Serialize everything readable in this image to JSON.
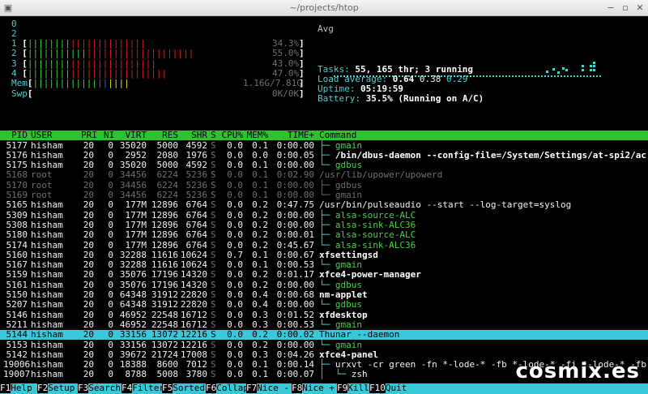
{
  "window": {
    "title": "~/projects/htop"
  },
  "cpus": [
    {
      "label": "1",
      "value": "34.3%",
      "green": 8,
      "red": 14
    },
    {
      "label": "2",
      "value": "55.0%",
      "green": 11,
      "red": 20
    },
    {
      "label": "3",
      "value": "43.0%",
      "green": 8,
      "red": 16
    },
    {
      "label": "4",
      "value": "47.0%",
      "green": 8,
      "red": 18
    }
  ],
  "cpu0_value": "",
  "mem": {
    "label": "Mem",
    "value": "1.16G/7.81G",
    "green": 12,
    "blue": 2,
    "yellow": 4
  },
  "swp": {
    "label": "Swp",
    "value": "0K/0K"
  },
  "avg_label": "Avg",
  "tasks": {
    "label": "Tasks: ",
    "value": "55, 165 thr; 3 running"
  },
  "load": {
    "label": "Load average: ",
    "v1": "0.64",
    "v2": "0.38",
    "v3": "0.29"
  },
  "uptime": {
    "label": "Uptime: ",
    "value": "05:19:59"
  },
  "battery": {
    "label": "Battery: ",
    "value": "35.5% (Running on A/C)"
  },
  "columns": [
    "PID",
    "USER",
    "PRI",
    "NI",
    "VIRT",
    "RES",
    "SHR",
    "S",
    "CPU%",
    "MEM%",
    "TIME+",
    "Command"
  ],
  "rows": [
    [
      "5177",
      "hisham",
      "20",
      "0",
      "35020",
      "5000",
      "4592",
      "S",
      "0.0",
      "0.1",
      "0:00.00",
      "├─ gmain",
      "n"
    ],
    [
      "5176",
      "hisham",
      "20",
      "0",
      "2952",
      "2080",
      "1976",
      "S",
      "0.0",
      "0.0",
      "0:00.05",
      "├─ /bin/dbus-daemon --config-file=/System/Settings/at-spi2/ac",
      "b"
    ],
    [
      "5175",
      "hisham",
      "20",
      "0",
      "35020",
      "5000",
      "4592",
      "S",
      "0.0",
      "0.1",
      "0:00.00",
      "└─ gdbus",
      "n"
    ],
    [
      "5168",
      "root",
      "20",
      "0",
      "34456",
      "6224",
      "5236",
      "S",
      "0.0",
      "0.1",
      "0:02.90",
      "/usr/lib/upower/upowerd",
      "g"
    ],
    [
      "5170",
      "root",
      "20",
      "0",
      "34456",
      "6224",
      "5236",
      "S",
      "0.0",
      "0.1",
      "0:00.00",
      "├─ gdbus",
      "g"
    ],
    [
      "5169",
      "root",
      "20",
      "0",
      "34456",
      "6224",
      "5236",
      "S",
      "0.0",
      "0.1",
      "0:00.00",
      "└─ gmain",
      "g"
    ],
    [
      "5165",
      "hisham",
      "20",
      "0",
      "177M",
      "12896",
      "6764",
      "S",
      "0.0",
      "0.2",
      "0:47.75",
      "/usr/bin/pulseaudio --start --log-target=syslog",
      "w"
    ],
    [
      "5309",
      "hisham",
      "20",
      "0",
      "177M",
      "12896",
      "6764",
      "S",
      "0.0",
      "0.2",
      "0:00.00",
      "├─ alsa-source-ALC",
      "n"
    ],
    [
      "5308",
      "hisham",
      "20",
      "0",
      "177M",
      "12896",
      "6764",
      "S",
      "0.0",
      "0.2",
      "0:00.00",
      "├─ alsa-sink-ALC36",
      "n"
    ],
    [
      "5180",
      "hisham",
      "20",
      "0",
      "177M",
      "12896",
      "6764",
      "S",
      "0.0",
      "0.2",
      "0:00.01",
      "├─ alsa-source-ALC",
      "n"
    ],
    [
      "5174",
      "hisham",
      "20",
      "0",
      "177M",
      "12896",
      "6764",
      "S",
      "0.0",
      "0.2",
      "0:45.67",
      "└─ alsa-sink-ALC36",
      "n"
    ],
    [
      "5160",
      "hisham",
      "20",
      "0",
      "32288",
      "11616",
      "10624",
      "S",
      "0.7",
      "0.1",
      "0:00.67",
      "xfsettingsd",
      "b"
    ],
    [
      "5167",
      "hisham",
      "20",
      "0",
      "32288",
      "11616",
      "10624",
      "S",
      "0.0",
      "0.1",
      "0:00.53",
      "└─ gmain",
      "n"
    ],
    [
      "5159",
      "hisham",
      "20",
      "0",
      "35076",
      "17196",
      "14320",
      "S",
      "0.0",
      "0.2",
      "0:01.17",
      "xfce4-power-manager",
      "b"
    ],
    [
      "5161",
      "hisham",
      "20",
      "0",
      "35076",
      "17196",
      "14320",
      "S",
      "0.0",
      "0.2",
      "0:00.00",
      "└─ gdbus",
      "n"
    ],
    [
      "5150",
      "hisham",
      "20",
      "0",
      "64348",
      "31912",
      "22820",
      "S",
      "0.0",
      "0.4",
      "0:00.68",
      "nm-applet",
      "b"
    ],
    [
      "5207",
      "hisham",
      "20",
      "0",
      "64348",
      "31912",
      "22820",
      "S",
      "0.0",
      "0.4",
      "0:00.00",
      "└─ gdbus",
      "n"
    ],
    [
      "5146",
      "hisham",
      "20",
      "0",
      "46952",
      "22548",
      "16712",
      "S",
      "0.0",
      "0.3",
      "0:01.52",
      "xfdesktop",
      "b"
    ],
    [
      "5211",
      "hisham",
      "20",
      "0",
      "46952",
      "22548",
      "16712",
      "S",
      "0.0",
      "0.3",
      "0:00.53",
      "└─ gmain",
      "n"
    ],
    [
      "5144",
      "hisham",
      "20",
      "0",
      "33156",
      "13072",
      "12216",
      "S",
      "0.0",
      "0.2",
      "0:00.02",
      "Thunar --daemon",
      "s"
    ],
    [
      "5153",
      "hisham",
      "20",
      "0",
      "33156",
      "13072",
      "12216",
      "S",
      "0.0",
      "0.2",
      "0:00.00",
      "└─ gmain",
      "n"
    ],
    [
      "5142",
      "hisham",
      "20",
      "0",
      "39672",
      "21724",
      "17008",
      "S",
      "0.0",
      "0.3",
      "0:04.26",
      "xfce4-panel",
      "b"
    ],
    [
      "19006",
      "hisham",
      "20",
      "0",
      "18388",
      "8600",
      "7012",
      "S",
      "0.0",
      "0.1",
      "0:00.14",
      "├─ urxvt -cr green -fn *-lode-* -fb *-lode-* -fi *-lode-* -fb",
      "w"
    ],
    [
      "19007",
      "hisham",
      "20",
      "0",
      "8788",
      "5008",
      "3780",
      "S",
      "0.0",
      "0.1",
      "0:00.07",
      "│  └─ zsh",
      "w"
    ]
  ],
  "footer": [
    {
      "key": "F1",
      "label": "Help"
    },
    {
      "key": "F2",
      "label": "Setup"
    },
    {
      "key": "F3",
      "label": "Search"
    },
    {
      "key": "F4",
      "label": "Filter"
    },
    {
      "key": "F5",
      "label": "Sorted"
    },
    {
      "key": "F6",
      "label": "Collap"
    },
    {
      "key": "F7",
      "label": "Nice -"
    },
    {
      "key": "F8",
      "label": "Nice +"
    },
    {
      "key": "F9",
      "label": "Kill"
    },
    {
      "key": "F10",
      "label": "Quit"
    }
  ],
  "watermark": "cosmix.es",
  "colors": {
    "header_bg": "#30c030",
    "selected_bg": "#38c8d8",
    "footer_bg": "#38c8d8"
  }
}
